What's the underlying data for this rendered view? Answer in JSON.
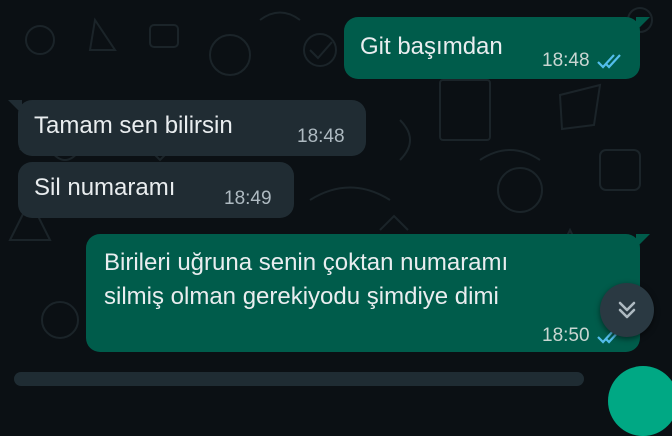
{
  "chat": {
    "messages": [
      {
        "text": "Git başımdan",
        "time": "18:48",
        "direction": "outgoing",
        "status": "read"
      },
      {
        "text": "Tamam sen bilirsin",
        "time": "18:48",
        "direction": "incoming"
      },
      {
        "text": "Sil numaramı",
        "time": "18:49",
        "direction": "incoming"
      },
      {
        "lines": [
          "Birileri uğruna senin çoktan numaramı",
          "silmiş olman gerekiyodu şimdiye dimi"
        ],
        "time": "18:50",
        "direction": "outgoing",
        "status": "read"
      }
    ]
  },
  "icons": {
    "read_receipt": "double-check-icon",
    "scroll_down": "double-chevron-down-icon"
  },
  "colors": {
    "background": "#0b1014",
    "outgoing_bubble": "#005c4b",
    "incoming_bubble": "#202c33",
    "read_tick": "#53bdeb",
    "accent": "#00a884"
  }
}
